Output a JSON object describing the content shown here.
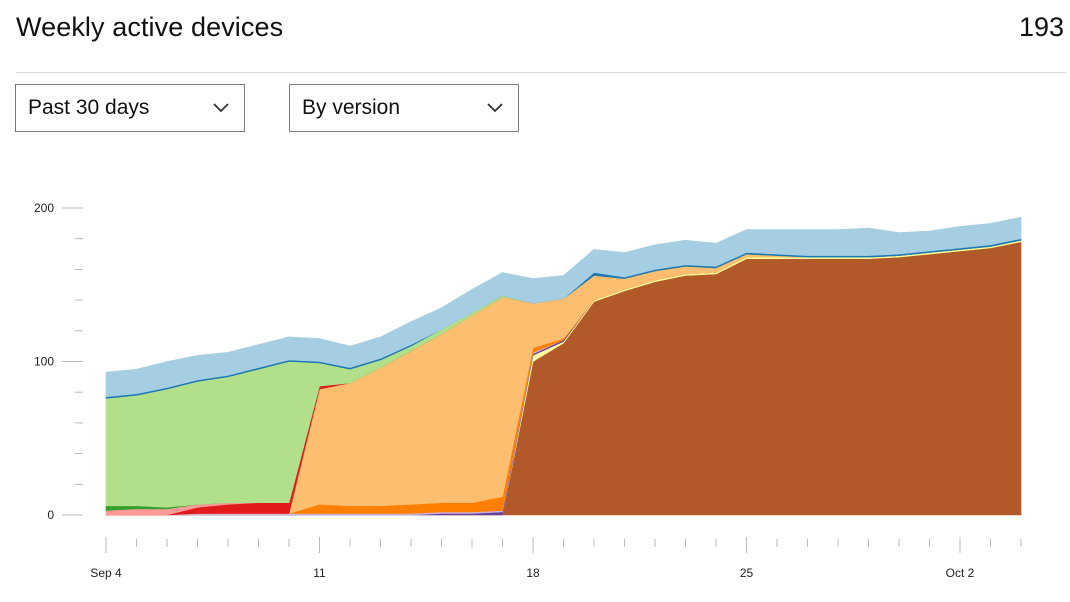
{
  "header": {
    "title": "Weekly active devices",
    "total": "193"
  },
  "filters": {
    "range": "Past 30 days",
    "group": "By version"
  },
  "chart_data": {
    "type": "area",
    "stacked": true,
    "title": "",
    "xlabel": "",
    "ylabel": "",
    "ylim": [
      0,
      200
    ],
    "y_ticks": [
      0,
      100,
      200
    ],
    "x_tick_labels": [
      {
        "day": 0,
        "label": "Sep 4"
      },
      {
        "day": 7,
        "label": "11"
      },
      {
        "day": 14,
        "label": "18"
      },
      {
        "day": 21,
        "label": "25"
      },
      {
        "day": 28,
        "label": "Oct 2"
      }
    ],
    "x": [
      0,
      1,
      2,
      3,
      4,
      5,
      6,
      7,
      8,
      9,
      10,
      11,
      12,
      13,
      14,
      15,
      16,
      17,
      18,
      19,
      20,
      21,
      22,
      23,
      24,
      25,
      26,
      27,
      28,
      29,
      30
    ],
    "series": [
      {
        "color": "#b15928",
        "values": [
          0,
          0,
          0,
          0,
          0,
          0,
          0,
          0,
          0,
          0,
          0,
          0,
          0,
          0,
          100,
          112,
          139,
          146,
          152,
          156,
          157,
          167,
          167,
          167,
          167,
          167,
          168,
          170,
          172,
          174,
          178
        ]
      },
      {
        "color": "#ffff99",
        "values": [
          0,
          0,
          0,
          0,
          0,
          0,
          0,
          0,
          0,
          0,
          0,
          0,
          0,
          0,
          4,
          1,
          1,
          1,
          1,
          1,
          1,
          1,
          1,
          1,
          1,
          1,
          1,
          1,
          1,
          1,
          1
        ]
      },
      {
        "color": "#6a3d9a",
        "values": [
          0,
          0,
          0,
          0,
          0,
          0,
          0,
          0,
          0,
          0,
          0,
          1,
          1,
          2,
          1,
          1,
          0,
          0,
          0,
          0,
          0,
          0,
          0,
          0,
          0,
          0,
          0,
          0,
          0,
          0,
          0
        ]
      },
      {
        "color": "#cab2d6",
        "values": [
          0,
          0,
          0,
          1,
          1,
          1,
          1,
          1,
          1,
          1,
          1,
          1,
          1,
          1,
          1,
          0,
          0,
          0,
          0,
          0,
          0,
          0,
          0,
          0,
          0,
          0,
          0,
          0,
          0,
          0,
          0
        ]
      },
      {
        "color": "#ff7f00",
        "values": [
          0,
          0,
          0,
          0,
          0,
          0,
          0,
          6,
          5,
          5,
          6,
          6,
          6,
          9,
          3,
          1,
          0,
          0,
          0,
          0,
          0,
          0,
          0,
          0,
          0,
          0,
          0,
          0,
          0,
          0,
          0
        ]
      },
      {
        "color": "#fdbf6f",
        "values": [
          0,
          0,
          0,
          0,
          0,
          0,
          0,
          75,
          80,
          90,
          100,
          110,
          122,
          130,
          29,
          26,
          16,
          7,
          6,
          5,
          3,
          2,
          1,
          0,
          0,
          0,
          0,
          0,
          0,
          0,
          0
        ]
      },
      {
        "color": "#e31a1c",
        "values": [
          0,
          0,
          0,
          4,
          6,
          7,
          7,
          2,
          0,
          0,
          0,
          0,
          0,
          0,
          0,
          0,
          0,
          0,
          0,
          0,
          0,
          0,
          0,
          0,
          0,
          0,
          0,
          0,
          0,
          0,
          0
        ]
      },
      {
        "color": "#fb9a99",
        "values": [
          3,
          4,
          4,
          2,
          1,
          0,
          0,
          0,
          0,
          0,
          0,
          0,
          0,
          0,
          0,
          0,
          0,
          0,
          0,
          0,
          0,
          0,
          0,
          0,
          0,
          0,
          0,
          0,
          0,
          0,
          0
        ]
      },
      {
        "color": "#33a02c",
        "values": [
          3,
          2,
          1,
          0,
          0,
          0,
          0,
          0,
          0,
          0,
          0,
          0,
          0,
          0,
          0,
          0,
          0,
          0,
          0,
          0,
          0,
          0,
          0,
          0,
          0,
          0,
          0,
          0,
          0,
          0,
          0
        ]
      },
      {
        "color": "#b2df8a",
        "values": [
          70,
          72,
          77,
          80,
          82,
          87,
          92,
          15,
          9,
          5,
          3,
          3,
          2,
          1,
          0,
          0,
          0,
          0,
          0,
          0,
          0,
          0,
          0,
          0,
          0,
          0,
          0,
          0,
          0,
          0,
          0
        ]
      },
      {
        "color": "#1f78b4",
        "values": [
          1,
          1,
          1,
          1,
          1,
          1,
          1,
          1,
          1,
          1,
          1,
          0,
          0,
          0,
          0,
          0,
          2,
          1,
          1,
          1,
          1,
          1,
          1,
          1,
          1,
          1,
          1,
          1,
          1,
          1,
          1
        ]
      },
      {
        "color": "#a6cee3",
        "values": [
          16,
          16,
          17,
          16,
          15,
          15,
          15,
          15,
          14,
          14,
          15,
          14,
          15,
          15,
          16,
          15,
          15,
          16,
          16,
          16,
          15,
          15,
          16,
          17,
          17,
          18,
          14,
          13,
          14,
          14,
          14
        ]
      }
    ]
  }
}
